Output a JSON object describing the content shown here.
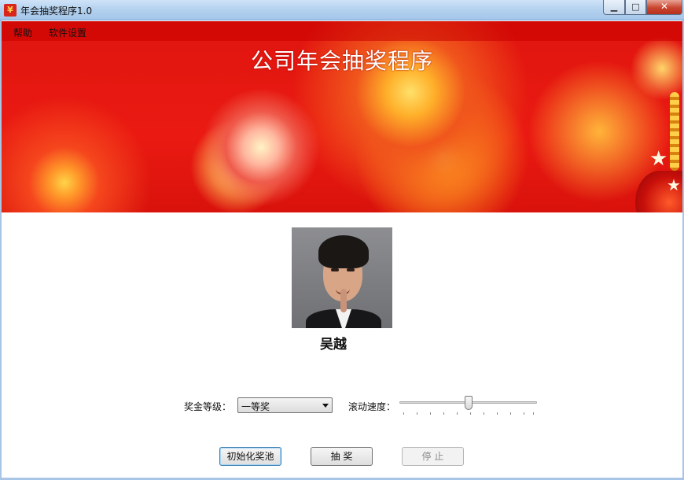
{
  "window": {
    "title": "年会抽奖程序1.0",
    "icon_glyph": "¥",
    "minimize_glyph": "▁",
    "maximize_glyph": "□",
    "close_glyph": "✕"
  },
  "menu": {
    "items": [
      {
        "label": "帮助"
      },
      {
        "label": "软件设置"
      }
    ]
  },
  "banner": {
    "title": "公司年会抽奖程序"
  },
  "winner": {
    "name": "吴越"
  },
  "controls": {
    "prize_level_label": "奖金等级：",
    "prize_level_value": "一等奖",
    "scroll_speed_label": "滚动速度：",
    "scroll_speed_value": 0.5
  },
  "buttons": {
    "init_pool": "初始化奖池",
    "draw": "抽 奖",
    "stop": "停 止"
  },
  "colors": {
    "banner_red": "#e0150f",
    "title_bar": "#b5d2ef"
  }
}
